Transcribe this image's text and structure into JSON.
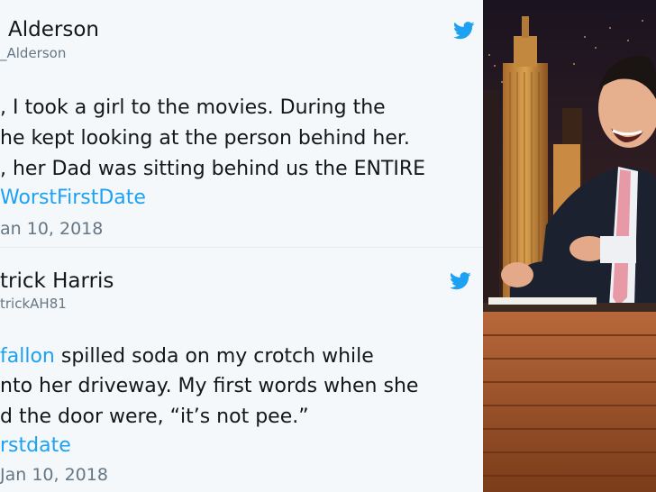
{
  "tweet1": {
    "name": "Alderson",
    "handle": "_Alderson",
    "lines": [
      ", I took a girl to the movies. During the",
      "he kept looking at the person behind her.",
      ", her Dad was sitting behind us the ENTIRE"
    ],
    "hashtag": "WorstFirstDate",
    "date": "an 10, 2018",
    "bird_icon": "twitter-bird-icon"
  },
  "tweet2": {
    "name": "trick Harris",
    "handle": "trickAH81",
    "mention": "fallon",
    "line1_rest": " spilled soda on my crotch while",
    "line2": "nto her driveway.  My first words when she",
    "line3": "d the door were, “it’s not pee.”",
    "hashtag": "rstdate",
    "date": "Jan 10, 2018",
    "bird_icon": "twitter-bird-icon"
  },
  "colors": {
    "link": "#1da1f2",
    "text": "#14171a",
    "secondary": "#657786",
    "background": "#f5f8fa"
  }
}
